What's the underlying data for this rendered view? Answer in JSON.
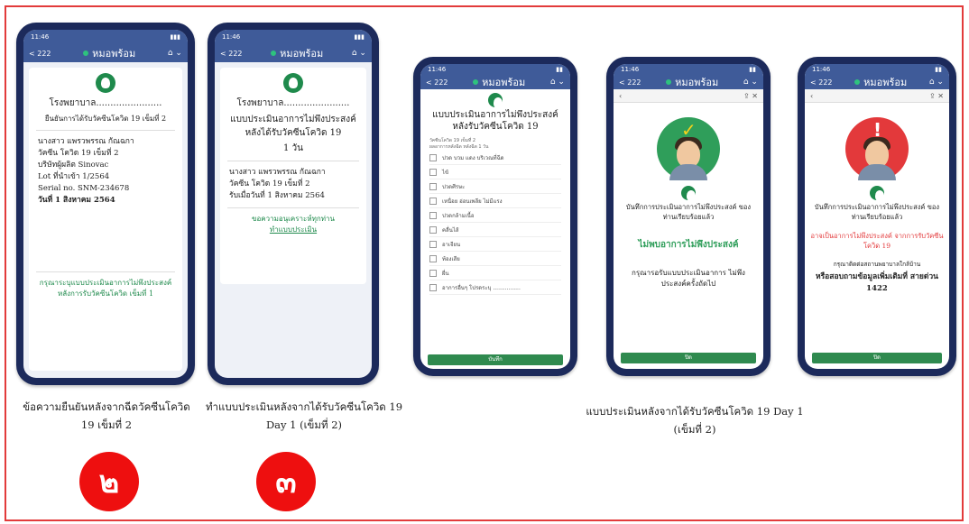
{
  "colors": {
    "frame": "#e23b3b",
    "phone": "#1c2a5b",
    "header": "#3f5b99",
    "green": "#1f8a4c",
    "badge": "#ee0f0f"
  },
  "status_time": "11:46",
  "nav_title": "หมอพร้อม",
  "nav_back": "< 222",
  "phone1": {
    "hospital": "โรงพยาบาล.......................",
    "subtitle": "ยืนยันการได้รับวัคซีนโควิด 19 เข็มที่ 2",
    "name": "นางสาว แพรวพรรณ กัณฉกา",
    "vaccine": "วัคซีน โควิด 19 เข็มที่ 2",
    "maker": "บริษัทผู้ผลิต Sinovac",
    "lot": "Lot ที่นำเข้า 1/2564",
    "serial": "Serial no. SNM-234678",
    "date": "วันที่ 1 สิงหาคม 2564",
    "link": "กรุณาระบุแบบประเมินอาการไม่พึงประสงค์ หลังการรับวัคซีนโควิด เข็มที่ 1"
  },
  "phone2": {
    "hospital": "โรงพยาบาล.......................",
    "title": "แบบประเมินอาการไม่พึงประสงค์ หลังได้รับวัคซีนโควิด 19",
    "days": "1 วัน",
    "name": "นางสาว แพรวพรรณ กัณฉกา",
    "vaccine": "วัคซีน โควิด 19 เข็มที่ 2",
    "date": "รับเมื่อวันที่ 1 สิงหาคม 2564",
    "thanks": "ขอความอนุเคราะห์ทุกท่าน",
    "action": "ทำแบบประเมิน"
  },
  "phone3": {
    "title": "แบบประเมินอาการไม่พึงประสงค์ หลังรับวัคซีนโควิด 19",
    "meta1": "วัคซีนโควิด 19 เข็มที่ 2",
    "meta2": "ผลอาการหลังฉีด หลังฉีด 1 วัน",
    "items": [
      "ปวด บวม แดง บริเวณที่ฉีด",
      "ไข้",
      "ปวดศีรษะ",
      "เหนื่อย อ่อนเพลีย ไม่มีแรง",
      "ปวดกล้ามเนื้อ",
      "คลื่นไส้",
      "อาเจียน",
      "ท้องเสีย",
      "ผื่น",
      "อาการอื่นๆ โปรดระบุ ................"
    ],
    "submit": "บันทึก"
  },
  "phone4": {
    "saved": "บันทึกการประเมินอาการไม่พึงประสงค์ ของท่านเรียบร้อยแล้ว",
    "result": "ไม่พบอาการไม่พึงประสงค์",
    "next": "กรุณารอรับแบบประเมินอาการ ไม่พึงประสงค์ครั้งถัดไป",
    "close": "ปิด"
  },
  "phone5": {
    "saved": "บันทึกการประเมินอาการไม่พึงประสงค์ ของท่านเรียบร้อยแล้ว",
    "warning": "อาจเป็นอาการไม่พึงประสงค์ จากการรับวัคซีนโควิด 19",
    "contact": "กรุณาติดต่อสถานพยาบาลใกล้บ้าน",
    "hotline": "หรือสอบถามข้อมูลเพิ่มเติมที่ สายด่วน 1422",
    "close": "ปิด"
  },
  "captions": {
    "c1a": "ข้อความยืนยันหลังจากฉีดวัคซีนโควิด",
    "c1b": "19 เข็มที่ 2",
    "c2a": "ทำแบบประเมินหลังจากได้รับวัคซีนโควิด 19",
    "c2b": "Day 1 (เข็มที่ 2)",
    "c3a": "แบบประเมินหลังจากได้รับวัคซีนโควิด 19 Day 1",
    "c3b": "(เข็มที่ 2)"
  },
  "badges": {
    "b2": "๒",
    "b3": "๓"
  }
}
